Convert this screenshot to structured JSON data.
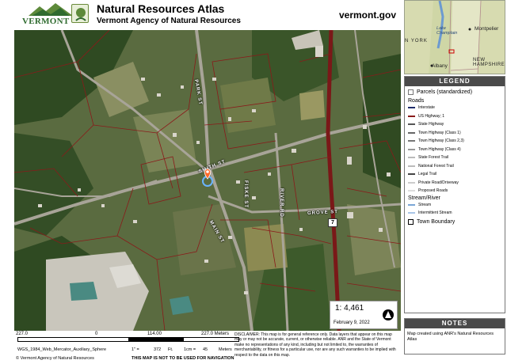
{
  "header": {
    "logo_text": "VERMONT",
    "title": "Natural Resources Atlas",
    "subtitle": "Vermont Agency of Natural Resources",
    "site": "vermont.gov"
  },
  "map": {
    "street_labels": {
      "smith": "SMITH ST",
      "fiske": "FISKE ST",
      "park": "PARK ST",
      "main": "MAIN ST",
      "river": "RIVER RD",
      "grove": "GROVE ST"
    },
    "route_shield": "7",
    "scale_ratio": "1:  4,461",
    "date": "February 9, 2022"
  },
  "inset": {
    "labels": {
      "ny": "N YORK",
      "lake": "Lake\nChamplain",
      "montpelier": "Montpelier",
      "albany": "Albany",
      "nh": "NEW\nHAMPSHIRE"
    }
  },
  "legend": {
    "title": "LEGEND",
    "parcels": "Parcels (standardized)",
    "roads_heading": "Roads",
    "roads": [
      {
        "label": "Interstate",
        "color": "#1f2d6b"
      },
      {
        "label": "US Highway; 1",
        "color": "#8a1a1a"
      },
      {
        "label": "State Highway",
        "color": "#555555"
      },
      {
        "label": "Town Highway (Class 1)",
        "color": "#666666"
      },
      {
        "label": "Town Highway (Class 2,3)",
        "color": "#777777"
      },
      {
        "label": "Town Highway (Class 4)",
        "color": "#999999"
      },
      {
        "label": "State Forest Trail",
        "color": "#bbbbbb"
      },
      {
        "label": "National Forest Trail",
        "color": "#bbbbbb"
      },
      {
        "label": "Legal Trail",
        "color": "#444444"
      },
      {
        "label": "Private Road/Driveway",
        "color": "#cccccc"
      },
      {
        "label": "Proposed Roads",
        "color": "#dddddd"
      }
    ],
    "stream_heading": "Stream/River",
    "streams": [
      {
        "label": "Stream",
        "color": "#7aa6d6"
      },
      {
        "label": "Intermittent Stream",
        "color": "#a9c6e8"
      }
    ],
    "town_boundary": "Town Boundary"
  },
  "notes": {
    "title": "NOTES",
    "text": "Map created using ANR's Natural Resources Atlas"
  },
  "footer": {
    "scale_labels": [
      "227.0",
      "0",
      "114.00",
      "227.0 Meters"
    ],
    "projection": "WGS_1984_Web_Mercator_Auxiliary_Sphere",
    "copyright": "© Vermont Agency of Natural Resources",
    "conversion": [
      "1\" =",
      "372",
      "Ft.",
      "1cm =",
      "45",
      "Meters"
    ],
    "nav_warning": "THIS MAP IS NOT TO BE USED FOR NAVIGATION",
    "disclaimer": "DISCLAIMER: This map is for general reference only. Data layers that appear on this map may or may not be accurate, current, or otherwise reliable. ANR and the State of Vermont make no representations of any kind, including but not limited to, the warranties of merchantability, or fitness for a particular use, nor are any such warranties to be implied with respect to the data on this map."
  },
  "colors": {
    "header_logo_green": "#2f6b2f",
    "highway_red": "#8a1a1a",
    "parcel_line": "#8a1a1a",
    "legend_header": "#4a4a4a"
  }
}
